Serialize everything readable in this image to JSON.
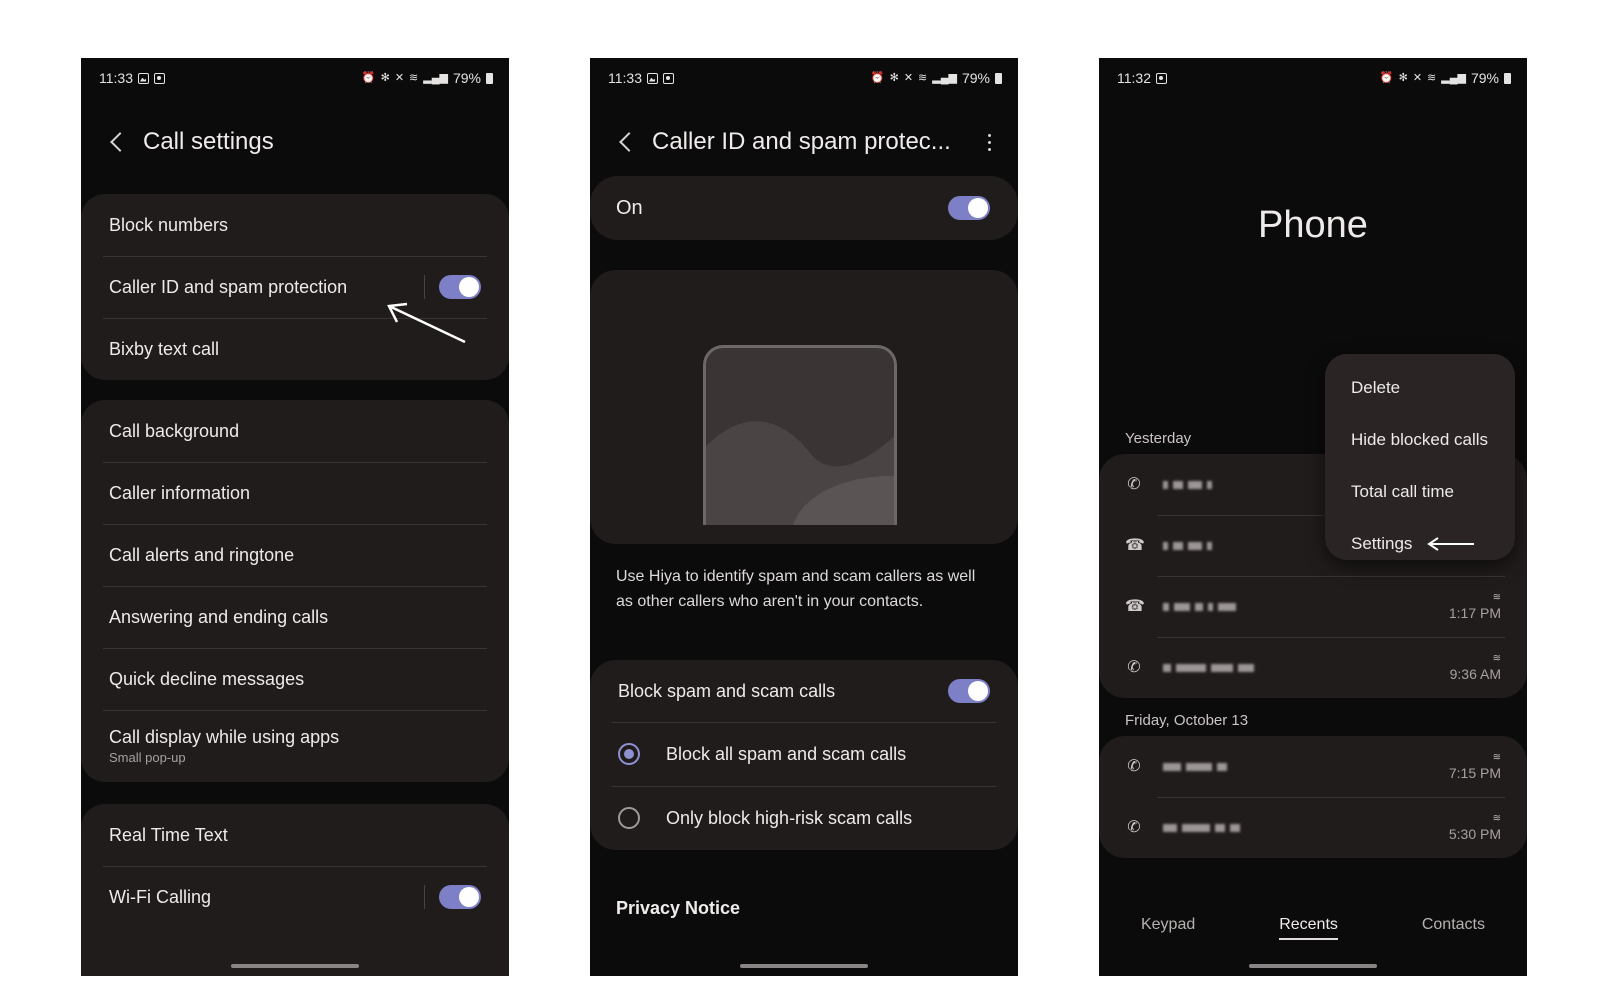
{
  "status_bars": {
    "left": {
      "time": "11:33",
      "battery": "79%"
    },
    "middle": {
      "time": "11:33",
      "battery": "79%"
    },
    "right": {
      "time": "11:32",
      "battery": "79%"
    }
  },
  "call_settings": {
    "title": "Call settings",
    "group1": [
      {
        "label": "Block numbers"
      },
      {
        "label": "Caller ID and spam protection",
        "toggle": true
      },
      {
        "label": "Bixby text call"
      }
    ],
    "group2": [
      {
        "label": "Call background"
      },
      {
        "label": "Caller information"
      },
      {
        "label": "Call alerts and ringtone"
      },
      {
        "label": "Answering and ending calls"
      },
      {
        "label": "Quick decline messages"
      },
      {
        "label": "Call display while using apps",
        "sub": "Small pop-up"
      }
    ],
    "group3": [
      {
        "label": "Real Time Text"
      },
      {
        "label": "Wi-Fi Calling",
        "toggle": true
      }
    ]
  },
  "caller_id": {
    "title": "Caller ID and spam protec...",
    "on_label": "On",
    "description": "Use Hiya to identify spam and scam callers as well as other callers who aren't in your contacts.",
    "block_label": "Block spam and scam calls",
    "options": [
      {
        "label": "Block all spam and scam calls",
        "selected": true
      },
      {
        "label": "Only block high-risk scam calls",
        "selected": false
      }
    ],
    "privacy": "Privacy Notice"
  },
  "phone_app": {
    "title": "Phone",
    "menu": [
      "Delete",
      "Hide blocked calls",
      "Total call time",
      "Settings"
    ],
    "sections": [
      {
        "label": "Yesterday",
        "calls": [
          {
            "icon": "outgoing-call-icon",
            "time": ""
          },
          {
            "icon": "missed-call-icon",
            "time": ""
          },
          {
            "icon": "missed-call-icon",
            "time": "1:17 PM"
          },
          {
            "icon": "incoming-call-icon",
            "time": "9:36 AM"
          }
        ]
      },
      {
        "label": "Friday, October 13",
        "calls": [
          {
            "icon": "outgoing-call-icon",
            "time": "7:15 PM"
          },
          {
            "icon": "incoming-call-icon",
            "time": "5:30 PM"
          }
        ]
      }
    ],
    "tabs": [
      "Keypad",
      "Recents",
      "Contacts"
    ],
    "active_tab": "Recents"
  },
  "colors": {
    "toggle_on": "#7d80c6",
    "card": "#211c1c",
    "background": "#0c0b0b"
  }
}
